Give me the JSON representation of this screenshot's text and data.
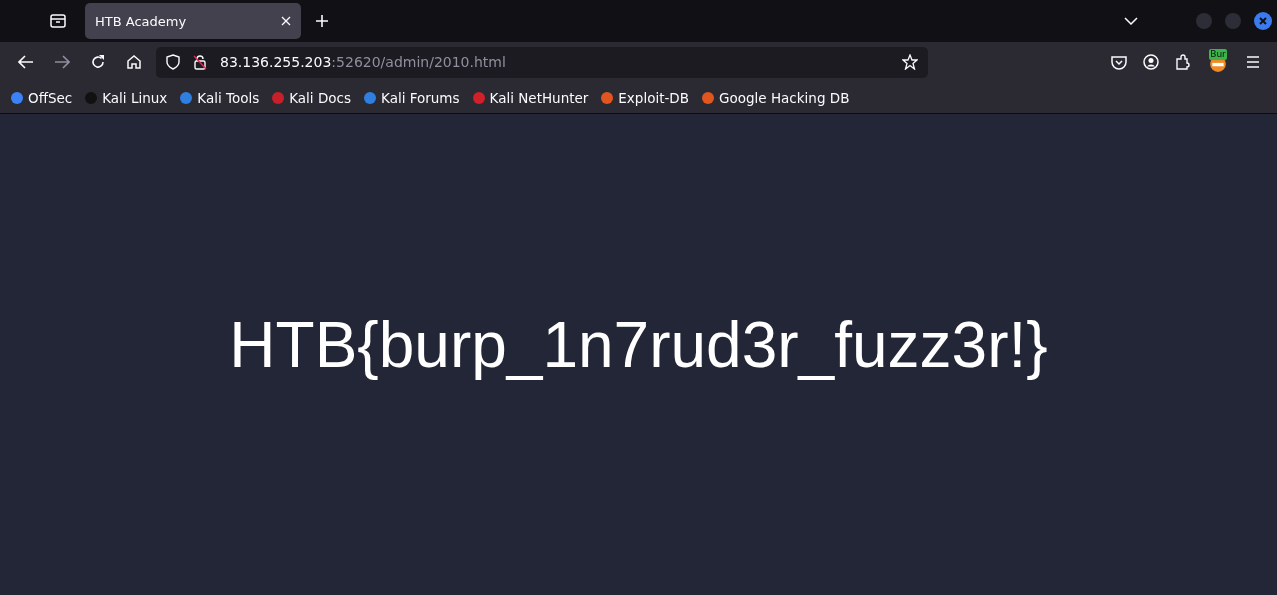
{
  "tabs": [
    {
      "title": "HTB Academy",
      "selected": true
    }
  ],
  "address": {
    "host": "83.136.255.203",
    "rest": ":52620/admin/2010.html"
  },
  "extension_badge": "Bur",
  "bookmarks": [
    {
      "label": "OffSec",
      "color": "#3b82f6"
    },
    {
      "label": "Kali Linux",
      "color": "#111111"
    },
    {
      "label": "Kali Tools",
      "color": "#2f7fe0"
    },
    {
      "label": "Kali Docs",
      "color": "#c8202a"
    },
    {
      "label": "Kali Forums",
      "color": "#2f7fe0"
    },
    {
      "label": "Kali NetHunter",
      "color": "#d0202a"
    },
    {
      "label": "Exploit-DB",
      "color": "#e0561e"
    },
    {
      "label": "Google Hacking DB",
      "color": "#e0561e"
    }
  ],
  "page": {
    "text": "HTB{burp_1n7rud3r_fuzz3r!}"
  }
}
